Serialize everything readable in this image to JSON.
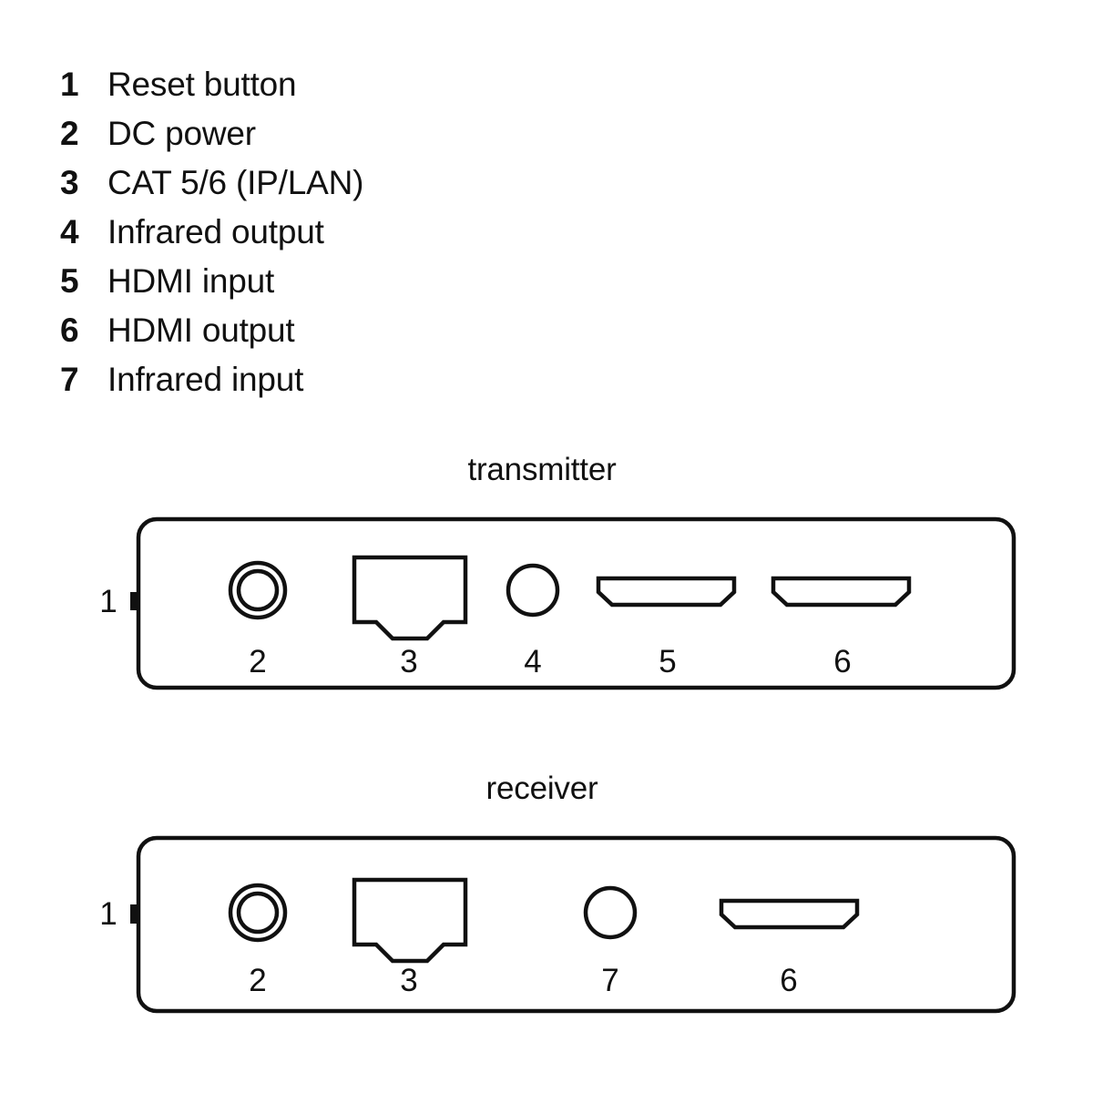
{
  "legend": {
    "items": [
      {
        "num": "1",
        "label": "Reset button"
      },
      {
        "num": "2",
        "label": "DC power"
      },
      {
        "num": "3",
        "label": "CAT 5/6 (IP/LAN)"
      },
      {
        "num": "4",
        "label": "Infrared output"
      },
      {
        "num": "5",
        "label": "HDMI input"
      },
      {
        "num": "6",
        "label": "HDMI output"
      },
      {
        "num": "7",
        "label": "Infrared input"
      }
    ]
  },
  "devices": {
    "transmitter": {
      "title": "transmitter",
      "edge_label": "1",
      "port_labels": [
        "2",
        "3",
        "4",
        "5",
        "6"
      ]
    },
    "receiver": {
      "title": "receiver",
      "edge_label": "1",
      "port_labels": [
        "2",
        "3",
        "7",
        "6"
      ]
    }
  },
  "colors": {
    "stroke": "#111111",
    "background": "#ffffff"
  }
}
